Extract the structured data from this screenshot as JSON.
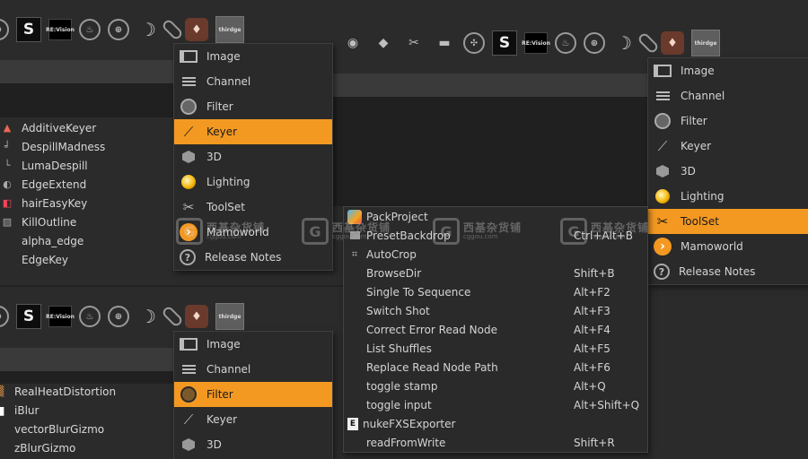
{
  "toolbar_glyphs": {
    "s_logo": "S",
    "revision": "RE:Vision",
    "thirdge": "thirdge",
    "eye": "◉",
    "tag": "◆",
    "wrench": "✂",
    "box": "▬",
    "crosshair": "✣",
    "flame": "♨",
    "gizmo": "⊕",
    "moon": "☽",
    "drop": "♦"
  },
  "menu_top_left": {
    "items": [
      "Image",
      "Channel",
      "Filter",
      "Keyer",
      "3D",
      "Lighting",
      "ToolSet",
      "Mamoworld",
      "Release Notes"
    ],
    "active": "Keyer"
  },
  "menu_bottom_left": {
    "items": [
      "Image",
      "Channel",
      "Filter",
      "Keyer",
      "3D"
    ],
    "active": "Filter"
  },
  "menu_right": {
    "items": [
      "Image",
      "Channel",
      "Filter",
      "Keyer",
      "3D",
      "Lighting",
      "ToolSet",
      "Mamoworld",
      "Release Notes"
    ],
    "active": "ToolSet"
  },
  "keyer_nodes": [
    "AdditiveKeyer",
    "DespillMadness",
    "LumaDespill",
    "EdgeExtend",
    "hairEasyKey",
    "KillOutline",
    "alpha_edge",
    "EdgeKey"
  ],
  "filter_nodes": [
    "RealHeatDistortion",
    "iBlur",
    "vectorBlurGizmo",
    "zBlurGizmo"
  ],
  "toolset_submenu": [
    {
      "label": "PackProject",
      "shortcut": ""
    },
    {
      "label": "PresetBackdrop",
      "shortcut": "Ctrl+Alt+B"
    },
    {
      "label": "AutoCrop",
      "shortcut": ""
    },
    {
      "label": "BrowseDir",
      "shortcut": "Shift+B"
    },
    {
      "label": "Single To Sequence",
      "shortcut": "Alt+F2"
    },
    {
      "label": "Switch Shot",
      "shortcut": "Alt+F3"
    },
    {
      "label": "Correct Error Read Node",
      "shortcut": "Alt+F4"
    },
    {
      "label": "List Shuffles",
      "shortcut": "Alt+F5"
    },
    {
      "label": "Replace Read Node Path",
      "shortcut": "Alt+F6"
    },
    {
      "label": "toggle stamp",
      "shortcut": "Alt+Q"
    },
    {
      "label": "toggle input",
      "shortcut": "Alt+Shift+Q"
    },
    {
      "label": "nukeFXSExporter",
      "shortcut": ""
    },
    {
      "label": "readFromWrite",
      "shortcut": "Shift+R"
    }
  ],
  "watermark": {
    "badge": "G",
    "name": "西基杂货铺",
    "site": "cggou.com"
  },
  "colors": {
    "accent": "#f39922",
    "menu_bg": "#2a2a2a",
    "panel_bg": "#2b2b2b"
  }
}
